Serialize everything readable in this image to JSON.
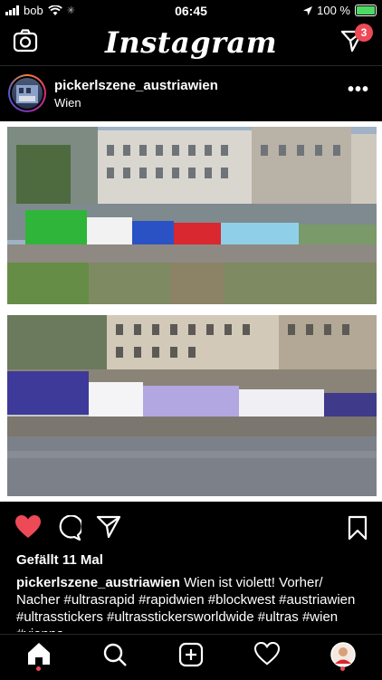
{
  "status": {
    "carrier": "bob",
    "time": "06:45",
    "battery": "100 %"
  },
  "app": {
    "title": "Instagram",
    "notification_count": "3"
  },
  "post": {
    "username": "pickerlszene_austriawien",
    "location": "Wien",
    "likes": "Gefällt 11 Mal",
    "caption_user": "pickerlszene_austriawien",
    "caption_text": "Wien ist violett! Vorher/ Nacher #ultrasrapid #rapidwien #blockwest #austriawien #ultrasstickers #ultrasstickersworldwide #ultras #wien #vienna"
  },
  "icons": {
    "camera": "camera-icon",
    "direct": "direct-message-icon",
    "more": "more-options-icon",
    "like": "heart-filled-icon",
    "comment": "comment-icon",
    "share": "share-icon",
    "save": "bookmark-icon",
    "home": "home-icon",
    "search": "search-icon",
    "add": "add-post-icon",
    "activity": "heart-outline-icon",
    "profile": "profile-avatar-icon"
  },
  "colors": {
    "accent_red": "#ed4956",
    "battery_green": "#4cd964",
    "background": "#000000"
  }
}
